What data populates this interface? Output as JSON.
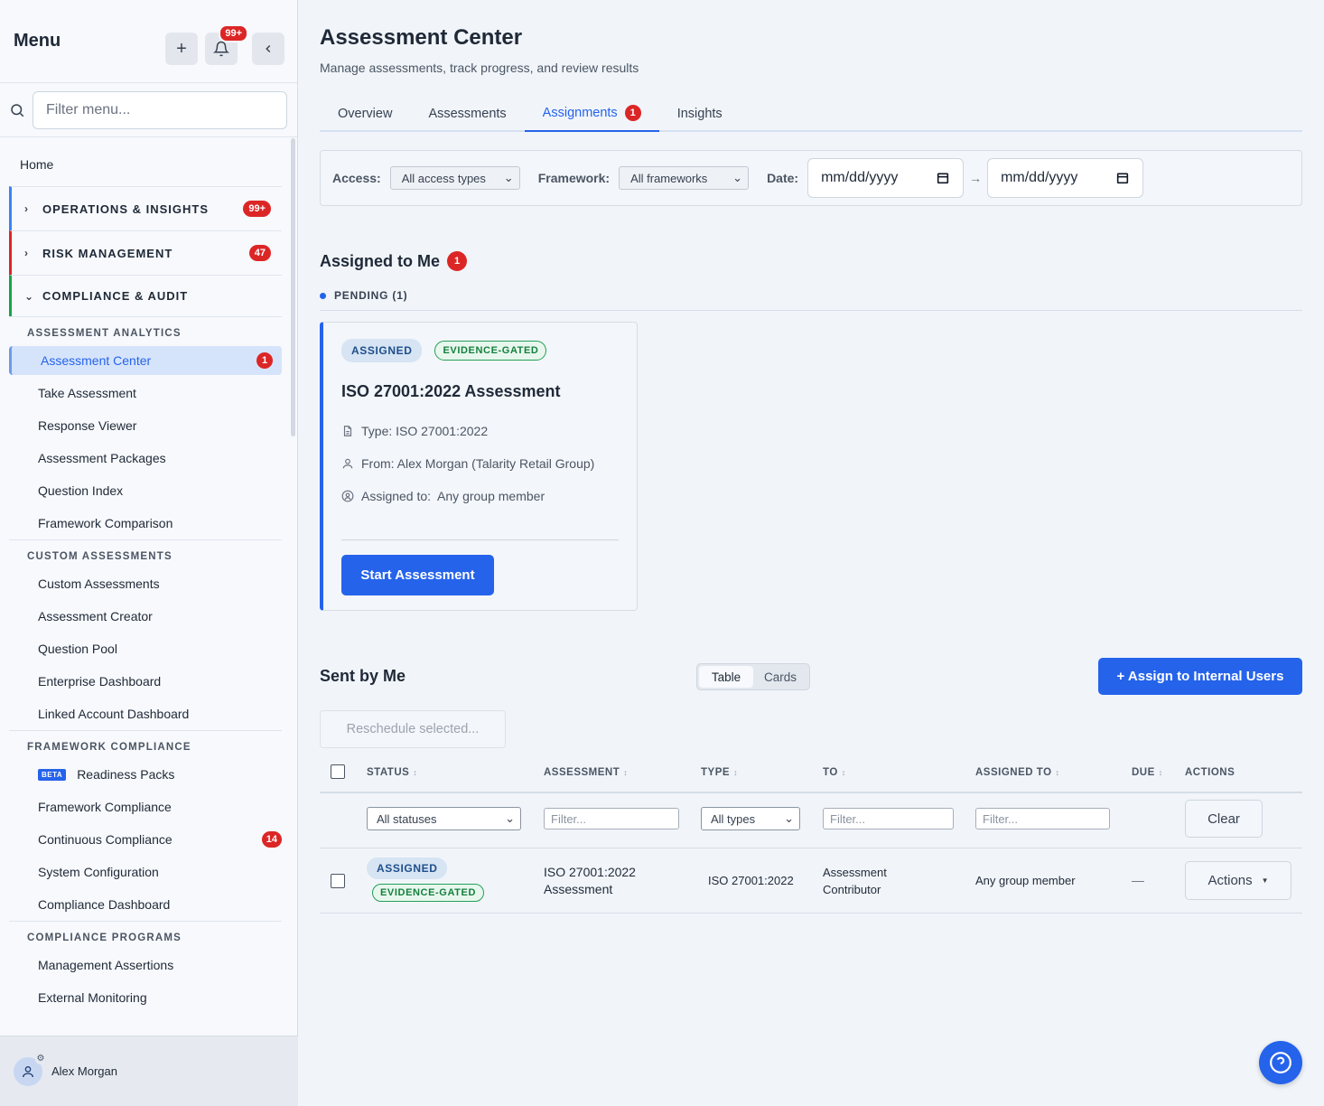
{
  "sidebar": {
    "title": "Menu",
    "notification_count": "99+",
    "search_placeholder": "Filter menu...",
    "home": "Home",
    "groups": [
      {
        "label": "OPERATIONS & INSIGHTS",
        "badge": "99+"
      },
      {
        "label": "RISK MANAGEMENT",
        "badge": "47"
      },
      {
        "label": "COMPLIANCE & AUDIT",
        "badge": ""
      }
    ],
    "sections": [
      {
        "title": "ASSESSMENT ANALYTICS",
        "items": [
          {
            "label": "Assessment Center",
            "badge": "1"
          },
          {
            "label": "Take Assessment"
          },
          {
            "label": "Response Viewer"
          },
          {
            "label": "Assessment Packages"
          },
          {
            "label": "Question Index"
          },
          {
            "label": "Framework Comparison"
          }
        ]
      },
      {
        "title": "CUSTOM ASSESSMENTS",
        "items": [
          {
            "label": "Custom Assessments"
          },
          {
            "label": "Assessment Creator"
          },
          {
            "label": "Question Pool"
          },
          {
            "label": "Enterprise Dashboard"
          },
          {
            "label": "Linked Account Dashboard"
          }
        ]
      },
      {
        "title": "FRAMEWORK COMPLIANCE",
        "items": [
          {
            "label": "Readiness Packs",
            "tag": "BETA"
          },
          {
            "label": "Framework Compliance"
          },
          {
            "label": "Continuous Compliance",
            "badge": "14"
          },
          {
            "label": "System Configuration"
          },
          {
            "label": "Compliance Dashboard"
          }
        ]
      },
      {
        "title": "COMPLIANCE PROGRAMS",
        "items": [
          {
            "label": "Management Assertions"
          },
          {
            "label": "External Monitoring"
          }
        ]
      }
    ],
    "user": "Alex Morgan"
  },
  "main": {
    "title": "Assessment Center",
    "subtitle": "Manage assessments, track progress, and review results",
    "tabs": [
      {
        "label": "Overview"
      },
      {
        "label": "Assessments"
      },
      {
        "label": "Assignments",
        "badge": "1",
        "active": true
      },
      {
        "label": "Insights"
      }
    ],
    "filters": {
      "access_label": "Access:",
      "access_value": "All access types",
      "framework_label": "Framework:",
      "framework_value": "All frameworks",
      "date_label": "Date:",
      "date_from": "mm/dd/yyyy",
      "date_arrow": "→",
      "date_to": "mm/dd/yyyy"
    },
    "assigned": {
      "title": "Assigned to Me",
      "badge": "1",
      "pending_label": "PENDING (1)",
      "card": {
        "status": "ASSIGNED",
        "gate": "EVIDENCE-GATED",
        "title": "ISO 27001:2022 Assessment",
        "type": "Type: ISO 27001:2022",
        "from": "From: Alex Morgan (Talarity Retail Group)",
        "assigned_to": "Assigned to:  Any group member",
        "button": "Start Assessment"
      }
    },
    "sent": {
      "title": "Sent by Me",
      "view_table": "Table",
      "view_cards": "Cards",
      "assign_button": "+ Assign to Internal Users",
      "reschedule_button": "Reschedule selected...",
      "columns": [
        "STATUS",
        "ASSESSMENT",
        "TYPE",
        "TO",
        "ASSIGNED TO",
        "DUE",
        "ACTIONS"
      ],
      "filter_status": "All statuses",
      "filter_placeholder": "Filter...",
      "filter_type": "All types",
      "clear_button": "Clear",
      "rows": [
        {
          "status": "ASSIGNED",
          "gate": "EVIDENCE-GATED",
          "assessment": "ISO 27001:2022 Assessment",
          "type": "ISO 27001:2022",
          "to": "Assessment Contributor",
          "assigned_to": "Any group member",
          "due": "—",
          "actions": "Actions"
        }
      ]
    }
  },
  "colors": {
    "accent": "#2563eb",
    "danger": "#dc2626",
    "success": "#16a34a"
  }
}
